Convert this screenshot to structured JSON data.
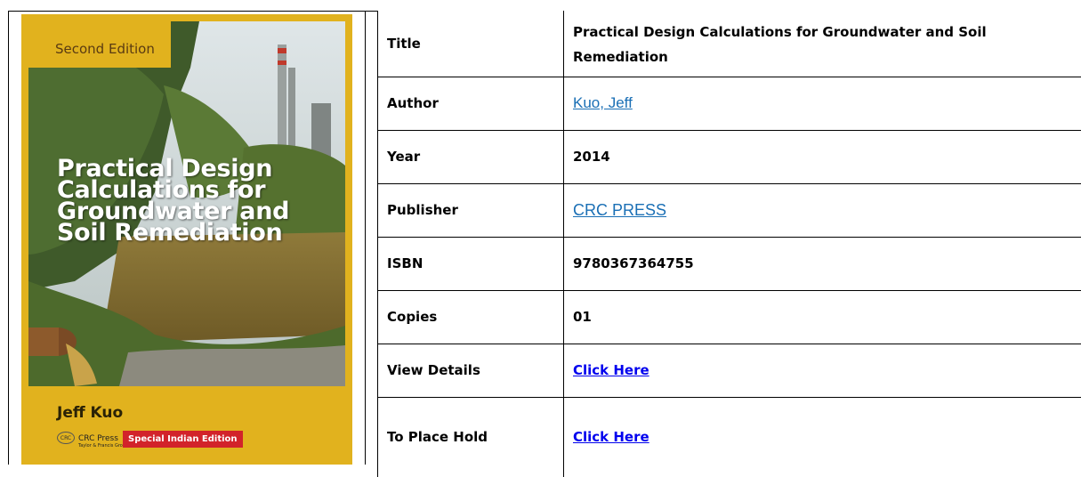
{
  "cover": {
    "edition": "Second Edition",
    "title_lines": [
      "Practical Design",
      "Calculations for",
      "Groundwater and",
      "Soil Remediation"
    ],
    "author": "Jeff Kuo",
    "press_logo": "CRC",
    "press_name": "CRC Press",
    "press_sub": "Taylor & Francis Group",
    "badge": "Special Indian Edition",
    "colors": {
      "frame": "#e1b21e",
      "badge": "#d2232a"
    }
  },
  "details": {
    "rows": [
      {
        "label": "Title",
        "value": "Practical Design Calculations for Groundwater and Soil Remediation"
      },
      {
        "label": "Author",
        "value": "Kuo, Jeff"
      },
      {
        "label": "Year",
        "value": "2014"
      },
      {
        "label": "Publisher",
        "value": "CRC PRESS"
      },
      {
        "label": "ISBN",
        "value": "9780367364755"
      },
      {
        "label": "Copies",
        "value": "01"
      },
      {
        "label": "View Details",
        "value": "Click Here"
      },
      {
        "label": "To Place Hold",
        "value": "Click Here"
      }
    ],
    "link_color": "#1a6fb5",
    "bold_link_color": "#0000ee"
  }
}
